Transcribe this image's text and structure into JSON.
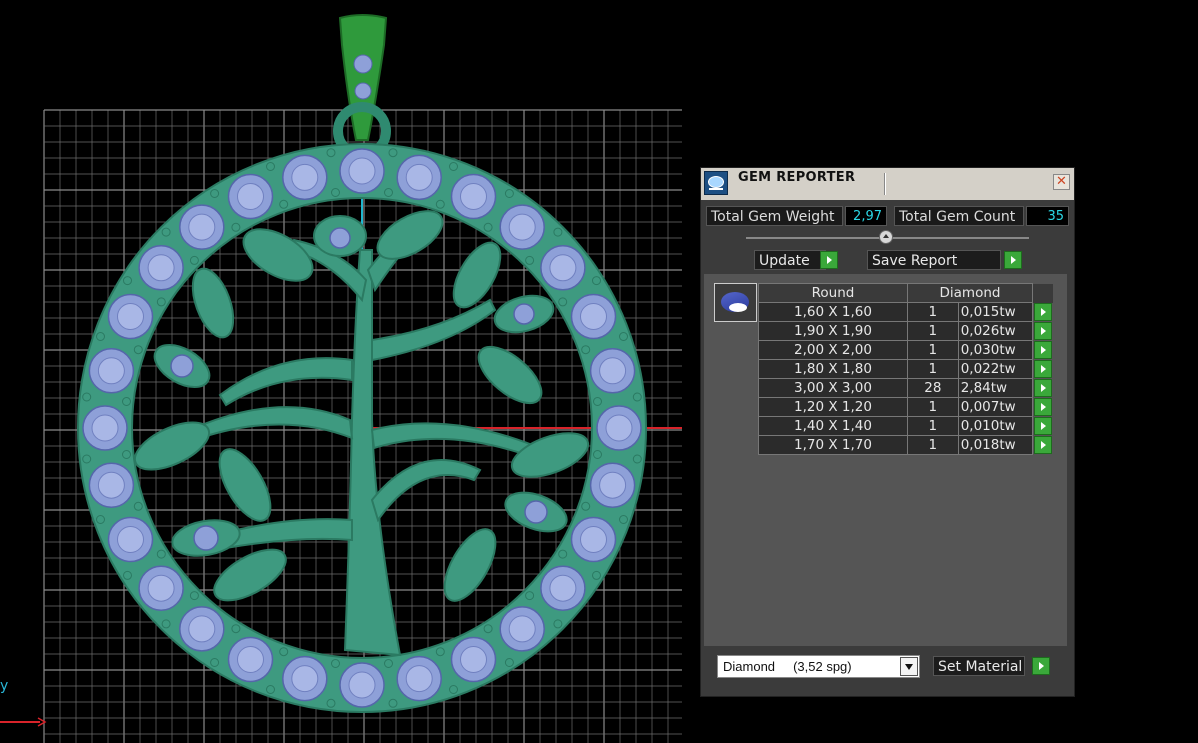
{
  "viewport": {
    "axis_label": "y",
    "colors": {
      "background": "#000000",
      "grid": "#6e6e6e",
      "metal": "#3e9a80",
      "gem": "#8ea0d8",
      "bail": "#2f9a3c",
      "axis_x": "#d8232a",
      "axis_y": "#1fb7d0"
    }
  },
  "panel": {
    "title": "GEM REPORTER",
    "close_icon": "close-icon",
    "total_gem_weight_label": "Total Gem Weight",
    "total_gem_weight": "2,97",
    "total_gem_count_label": "Total Gem Count",
    "total_gem_count": "35",
    "update_label": "Update",
    "save_report_label": "Save Report",
    "table": {
      "shape": "Round",
      "material": "Diamond",
      "rows": [
        {
          "size": "1,60 X 1,60",
          "qty": "1",
          "weight": "0,015tw"
        },
        {
          "size": "1,90 X 1,90",
          "qty": "1",
          "weight": "0,026tw"
        },
        {
          "size": "2,00 X 2,00",
          "qty": "1",
          "weight": "0,030tw"
        },
        {
          "size": "1,80 X 1,80",
          "qty": "1",
          "weight": "0,022tw"
        },
        {
          "size": "3,00 X 3,00",
          "qty": "28",
          "weight": "2,84tw"
        },
        {
          "size": "1,20 X 1,20",
          "qty": "1",
          "weight": "0,007tw"
        },
        {
          "size": "1,40 X 1,40",
          "qty": "1",
          "weight": "0,010tw"
        },
        {
          "size": "1,70 X 1,70",
          "qty": "1",
          "weight": "0,018tw"
        }
      ]
    },
    "material_select": "Diamond     (3,52 spg)",
    "set_material_label": "Set Material"
  }
}
